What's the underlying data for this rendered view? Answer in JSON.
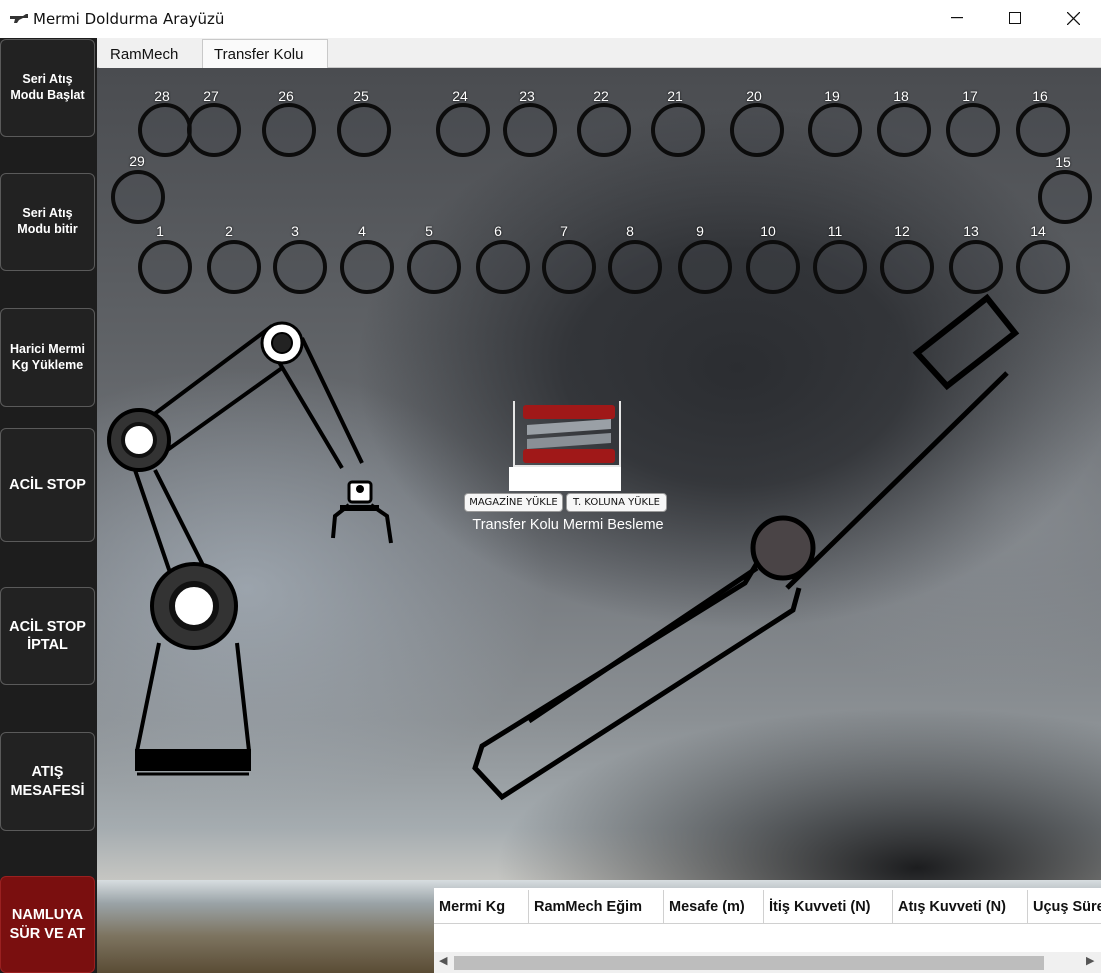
{
  "window": {
    "title": "Mermi Doldurma Arayüzü",
    "icon": "gun-icon",
    "minimize": "—",
    "maximize": "☐",
    "close": "✕"
  },
  "sidebar": {
    "buttons": [
      {
        "label": "Seri Atış\nModu Başlat"
      },
      {
        "label": "Seri Atış\nModu bitir"
      },
      {
        "label": "Harici Mermi\nKg Yükleme"
      },
      {
        "label": "ACİL STOP"
      },
      {
        "label": "ACİL STOP\nİPTAL"
      },
      {
        "label": "ATIŞ\nMESAFESİ"
      },
      {
        "label": "NAMLUYA\nSÜR VE AT",
        "color": "#7a0f0f"
      }
    ]
  },
  "tabs": [
    {
      "label": "RamMech",
      "active": false
    },
    {
      "label": "Transfer Kolu",
      "active": true
    }
  ],
  "magazine_slots": {
    "top_row": [
      "28",
      "27",
      "26",
      "25",
      "24",
      "23",
      "22",
      "21",
      "20",
      "19",
      "18",
      "17",
      "16"
    ],
    "left": "29",
    "right": "15",
    "bottom_row": [
      "1",
      "2",
      "3",
      "4",
      "5",
      "6",
      "7",
      "8",
      "9",
      "10",
      "11",
      "12",
      "13",
      "14"
    ]
  },
  "feeder": {
    "btn_magazine": "MAGAZİNE YÜKLE",
    "btn_arm": "T. KOLUNA YÜKLE",
    "caption": "Transfer Kolu Mermi Besleme"
  },
  "results_table": {
    "columns": [
      "Mermi Kg",
      "RamMech Eğim",
      "Mesafe (m)",
      "İtiş Kuvveti (N)",
      "Atış Kuvveti (N)",
      "Uçuş Süre"
    ],
    "rows": []
  }
}
